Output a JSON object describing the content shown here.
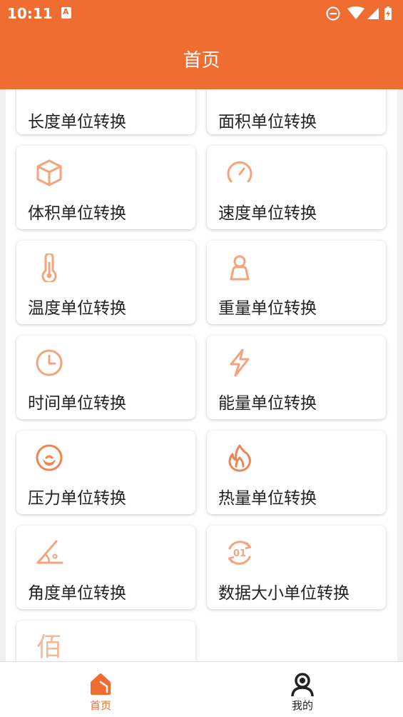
{
  "status": {
    "time": "10:11"
  },
  "header": {
    "title": "首页"
  },
  "cards": [
    {
      "label": "长度单位转换",
      "icon": "ruler-icon"
    },
    {
      "label": "面积单位转换",
      "icon": "area-icon"
    },
    {
      "label": "体积单位转换",
      "icon": "cube-icon"
    },
    {
      "label": "速度单位转换",
      "icon": "speedometer-icon"
    },
    {
      "label": "温度单位转换",
      "icon": "thermometer-icon"
    },
    {
      "label": "重量单位转换",
      "icon": "weight-icon"
    },
    {
      "label": "时间单位转换",
      "icon": "clock-icon"
    },
    {
      "label": "能量单位转换",
      "icon": "lightning-icon"
    },
    {
      "label": "压力单位转换",
      "icon": "pressure-icon"
    },
    {
      "label": "热量单位转换",
      "icon": "flame-icon"
    },
    {
      "label": "角度单位转换",
      "icon": "angle-icon"
    },
    {
      "label": "数据大小单位转换",
      "icon": "data-icon"
    },
    {
      "label": "",
      "icon": "hundred-icon",
      "glyph": "佰"
    }
  ],
  "bottom_nav": {
    "home_label": "首页",
    "mine_label": "我的"
  },
  "colors": {
    "accent": "#ef6d30",
    "icon": "#f4a47c"
  }
}
